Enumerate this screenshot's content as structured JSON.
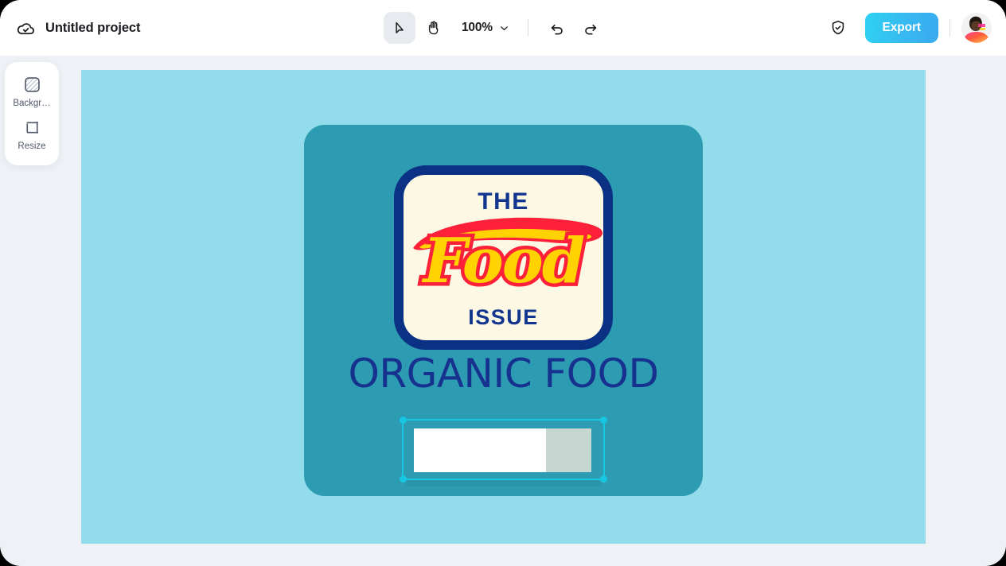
{
  "app": {
    "background_color": "#eef1f5",
    "window_radius_px": 26
  },
  "topbar": {
    "cloud_icon": "cloud-check-icon",
    "project_title": "Untitled project",
    "tools": [
      {
        "name": "select-tool",
        "icon": "cursor-arrow-icon",
        "active": true
      },
      {
        "name": "hand-tool",
        "icon": "hand-icon",
        "active": false
      }
    ],
    "zoom": {
      "level": "100%",
      "chevron_icon": "chevron-down-icon"
    },
    "history": [
      {
        "name": "undo-button",
        "icon": "undo-arrow-icon"
      },
      {
        "name": "redo-button",
        "icon": "redo-arrow-icon"
      }
    ],
    "shield_icon": "shield-check-icon",
    "export_label": "Export",
    "export_gradient_from": "#2fd2f2",
    "export_gradient_to": "#3aa9ee",
    "avatar": "user-avatar"
  },
  "sidebar": {
    "items": [
      {
        "label": "Backgr…",
        "icon": "background-pattern-icon",
        "name": "background"
      },
      {
        "label": "Resize",
        "icon": "resize-frame-icon",
        "name": "resize"
      }
    ]
  },
  "canvas": {
    "background_color": "#92dcec",
    "poster": {
      "card_color": "#2d9cb2",
      "logo": {
        "border_color": "#0a3184",
        "fill_color": "#fdf8e3",
        "top_text": "THE",
        "script_text": "Food",
        "script_fill": "#ffd200",
        "script_outline": "#fc2139",
        "bottom_text": "ISSUE"
      },
      "heading": "ORGANIC FOOD",
      "heading_color": "#17318f",
      "selected_object": {
        "selection_color": "#17c6e0",
        "handles": [
          "top-left",
          "top-right",
          "bottom-left",
          "bottom-right"
        ],
        "shape_white_color": "#ffffff",
        "shape_gray_color": "#c6d7d2"
      }
    }
  }
}
